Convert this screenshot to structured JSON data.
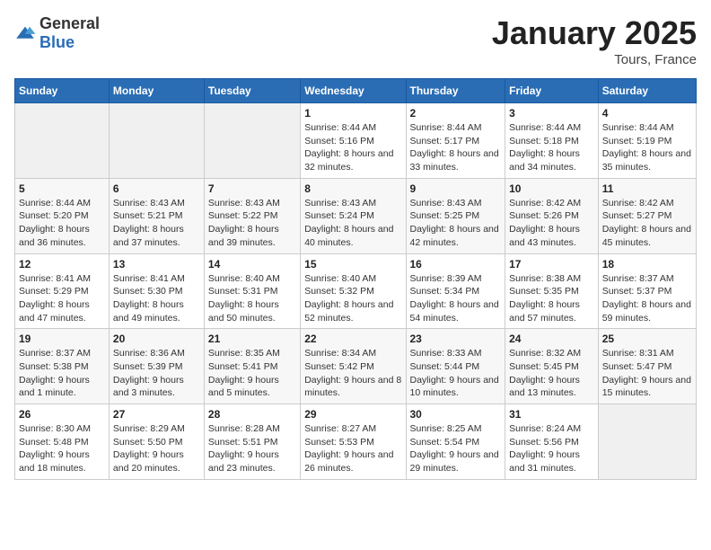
{
  "header": {
    "logo_general": "General",
    "logo_blue": "Blue",
    "title": "January 2025",
    "subtitle": "Tours, France"
  },
  "calendar": {
    "days_of_week": [
      "Sunday",
      "Monday",
      "Tuesday",
      "Wednesday",
      "Thursday",
      "Friday",
      "Saturday"
    ],
    "weeks": [
      [
        {
          "day": "",
          "empty": true
        },
        {
          "day": "",
          "empty": true
        },
        {
          "day": "",
          "empty": true
        },
        {
          "day": "1",
          "sunrise": "Sunrise: 8:44 AM",
          "sunset": "Sunset: 5:16 PM",
          "daylight": "Daylight: 8 hours and 32 minutes."
        },
        {
          "day": "2",
          "sunrise": "Sunrise: 8:44 AM",
          "sunset": "Sunset: 5:17 PM",
          "daylight": "Daylight: 8 hours and 33 minutes."
        },
        {
          "day": "3",
          "sunrise": "Sunrise: 8:44 AM",
          "sunset": "Sunset: 5:18 PM",
          "daylight": "Daylight: 8 hours and 34 minutes."
        },
        {
          "day": "4",
          "sunrise": "Sunrise: 8:44 AM",
          "sunset": "Sunset: 5:19 PM",
          "daylight": "Daylight: 8 hours and 35 minutes."
        }
      ],
      [
        {
          "day": "5",
          "sunrise": "Sunrise: 8:44 AM",
          "sunset": "Sunset: 5:20 PM",
          "daylight": "Daylight: 8 hours and 36 minutes."
        },
        {
          "day": "6",
          "sunrise": "Sunrise: 8:43 AM",
          "sunset": "Sunset: 5:21 PM",
          "daylight": "Daylight: 8 hours and 37 minutes."
        },
        {
          "day": "7",
          "sunrise": "Sunrise: 8:43 AM",
          "sunset": "Sunset: 5:22 PM",
          "daylight": "Daylight: 8 hours and 39 minutes."
        },
        {
          "day": "8",
          "sunrise": "Sunrise: 8:43 AM",
          "sunset": "Sunset: 5:24 PM",
          "daylight": "Daylight: 8 hours and 40 minutes."
        },
        {
          "day": "9",
          "sunrise": "Sunrise: 8:43 AM",
          "sunset": "Sunset: 5:25 PM",
          "daylight": "Daylight: 8 hours and 42 minutes."
        },
        {
          "day": "10",
          "sunrise": "Sunrise: 8:42 AM",
          "sunset": "Sunset: 5:26 PM",
          "daylight": "Daylight: 8 hours and 43 minutes."
        },
        {
          "day": "11",
          "sunrise": "Sunrise: 8:42 AM",
          "sunset": "Sunset: 5:27 PM",
          "daylight": "Daylight: 8 hours and 45 minutes."
        }
      ],
      [
        {
          "day": "12",
          "sunrise": "Sunrise: 8:41 AM",
          "sunset": "Sunset: 5:29 PM",
          "daylight": "Daylight: 8 hours and 47 minutes."
        },
        {
          "day": "13",
          "sunrise": "Sunrise: 8:41 AM",
          "sunset": "Sunset: 5:30 PM",
          "daylight": "Daylight: 8 hours and 49 minutes."
        },
        {
          "day": "14",
          "sunrise": "Sunrise: 8:40 AM",
          "sunset": "Sunset: 5:31 PM",
          "daylight": "Daylight: 8 hours and 50 minutes."
        },
        {
          "day": "15",
          "sunrise": "Sunrise: 8:40 AM",
          "sunset": "Sunset: 5:32 PM",
          "daylight": "Daylight: 8 hours and 52 minutes."
        },
        {
          "day": "16",
          "sunrise": "Sunrise: 8:39 AM",
          "sunset": "Sunset: 5:34 PM",
          "daylight": "Daylight: 8 hours and 54 minutes."
        },
        {
          "day": "17",
          "sunrise": "Sunrise: 8:38 AM",
          "sunset": "Sunset: 5:35 PM",
          "daylight": "Daylight: 8 hours and 57 minutes."
        },
        {
          "day": "18",
          "sunrise": "Sunrise: 8:37 AM",
          "sunset": "Sunset: 5:37 PM",
          "daylight": "Daylight: 8 hours and 59 minutes."
        }
      ],
      [
        {
          "day": "19",
          "sunrise": "Sunrise: 8:37 AM",
          "sunset": "Sunset: 5:38 PM",
          "daylight": "Daylight: 9 hours and 1 minute."
        },
        {
          "day": "20",
          "sunrise": "Sunrise: 8:36 AM",
          "sunset": "Sunset: 5:39 PM",
          "daylight": "Daylight: 9 hours and 3 minutes."
        },
        {
          "day": "21",
          "sunrise": "Sunrise: 8:35 AM",
          "sunset": "Sunset: 5:41 PM",
          "daylight": "Daylight: 9 hours and 5 minutes."
        },
        {
          "day": "22",
          "sunrise": "Sunrise: 8:34 AM",
          "sunset": "Sunset: 5:42 PM",
          "daylight": "Daylight: 9 hours and 8 minutes."
        },
        {
          "day": "23",
          "sunrise": "Sunrise: 8:33 AM",
          "sunset": "Sunset: 5:44 PM",
          "daylight": "Daylight: 9 hours and 10 minutes."
        },
        {
          "day": "24",
          "sunrise": "Sunrise: 8:32 AM",
          "sunset": "Sunset: 5:45 PM",
          "daylight": "Daylight: 9 hours and 13 minutes."
        },
        {
          "day": "25",
          "sunrise": "Sunrise: 8:31 AM",
          "sunset": "Sunset: 5:47 PM",
          "daylight": "Daylight: 9 hours and 15 minutes."
        }
      ],
      [
        {
          "day": "26",
          "sunrise": "Sunrise: 8:30 AM",
          "sunset": "Sunset: 5:48 PM",
          "daylight": "Daylight: 9 hours and 18 minutes."
        },
        {
          "day": "27",
          "sunrise": "Sunrise: 8:29 AM",
          "sunset": "Sunset: 5:50 PM",
          "daylight": "Daylight: 9 hours and 20 minutes."
        },
        {
          "day": "28",
          "sunrise": "Sunrise: 8:28 AM",
          "sunset": "Sunset: 5:51 PM",
          "daylight": "Daylight: 9 hours and 23 minutes."
        },
        {
          "day": "29",
          "sunrise": "Sunrise: 8:27 AM",
          "sunset": "Sunset: 5:53 PM",
          "daylight": "Daylight: 9 hours and 26 minutes."
        },
        {
          "day": "30",
          "sunrise": "Sunrise: 8:25 AM",
          "sunset": "Sunset: 5:54 PM",
          "daylight": "Daylight: 9 hours and 29 minutes."
        },
        {
          "day": "31",
          "sunrise": "Sunrise: 8:24 AM",
          "sunset": "Sunset: 5:56 PM",
          "daylight": "Daylight: 9 hours and 31 minutes."
        },
        {
          "day": "",
          "empty": true
        }
      ]
    ]
  }
}
